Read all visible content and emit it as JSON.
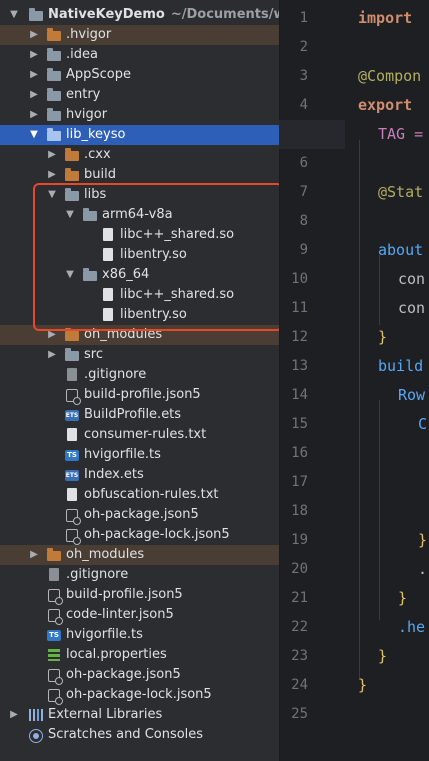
{
  "colors": {
    "selection": "#2e5fb8",
    "excluded_folder": "#4a3d33",
    "folder": "#8b98a6",
    "excluded_folder_icon": "#c07a3a",
    "highlight_box": "#e8472a",
    "keyword": "#cf8e6d",
    "decorator": "#b3ae60",
    "function": "#56a8f5"
  },
  "project_tree": {
    "root": {
      "name": "NativeKeyDemo",
      "path": "~/Documents/work"
    },
    "rows": [
      {
        "label": "NativeKeyDemo",
        "sub": "~/Documents/work"
      },
      {
        "label": ".hvigor"
      },
      {
        "label": ".idea"
      },
      {
        "label": "AppScope"
      },
      {
        "label": "entry"
      },
      {
        "label": "hvigor"
      },
      {
        "label": "lib_keyso"
      },
      {
        "label": ".cxx"
      },
      {
        "label": "build"
      },
      {
        "label": "libs"
      },
      {
        "label": "arm64-v8a"
      },
      {
        "label": "libc++_shared.so"
      },
      {
        "label": "libentry.so"
      },
      {
        "label": "x86_64"
      },
      {
        "label": "libc++_shared.so"
      },
      {
        "label": "libentry.so"
      },
      {
        "label": "oh_modules"
      },
      {
        "label": "src"
      },
      {
        "label": ".gitignore"
      },
      {
        "label": "build-profile.json5"
      },
      {
        "label": "BuildProfile.ets"
      },
      {
        "label": "consumer-rules.txt"
      },
      {
        "label": "hvigorfile.ts"
      },
      {
        "label": "Index.ets"
      },
      {
        "label": "obfuscation-rules.txt"
      },
      {
        "label": "oh-package.json5"
      },
      {
        "label": "oh-package-lock.json5"
      },
      {
        "label": "oh_modules"
      },
      {
        "label": ".gitignore"
      },
      {
        "label": "build-profile.json5"
      },
      {
        "label": "code-linter.json5"
      },
      {
        "label": "hvigorfile.ts"
      },
      {
        "label": "local.properties"
      },
      {
        "label": "oh-package.json5"
      },
      {
        "label": "oh-package-lock.json5"
      },
      {
        "label": "External Libraries"
      },
      {
        "label": "Scratches and Consoles"
      }
    ]
  },
  "editor": {
    "current_line": 5,
    "line_numbers": [
      "1",
      "2",
      "3",
      "4",
      "5",
      "6",
      "7",
      "8",
      "9",
      "10",
      "11",
      "12",
      "13",
      "14",
      "15",
      "16",
      "17",
      "18",
      "19",
      "20",
      "21",
      "22",
      "23",
      "24",
      "25"
    ],
    "code_fragments": {
      "l1": "import",
      "l3": "@Compon",
      "l4": "export",
      "l5": "TAG =",
      "l7": "@Stat",
      "l9": "about",
      "l10": "con",
      "l11": "con",
      "l12": "}",
      "l13": "build",
      "l14": "Row",
      "l15": "C",
      "l19": "}",
      "l20": ".",
      "l21": "}",
      "l22": ".he",
      "l23": "}",
      "l24": "}"
    }
  }
}
